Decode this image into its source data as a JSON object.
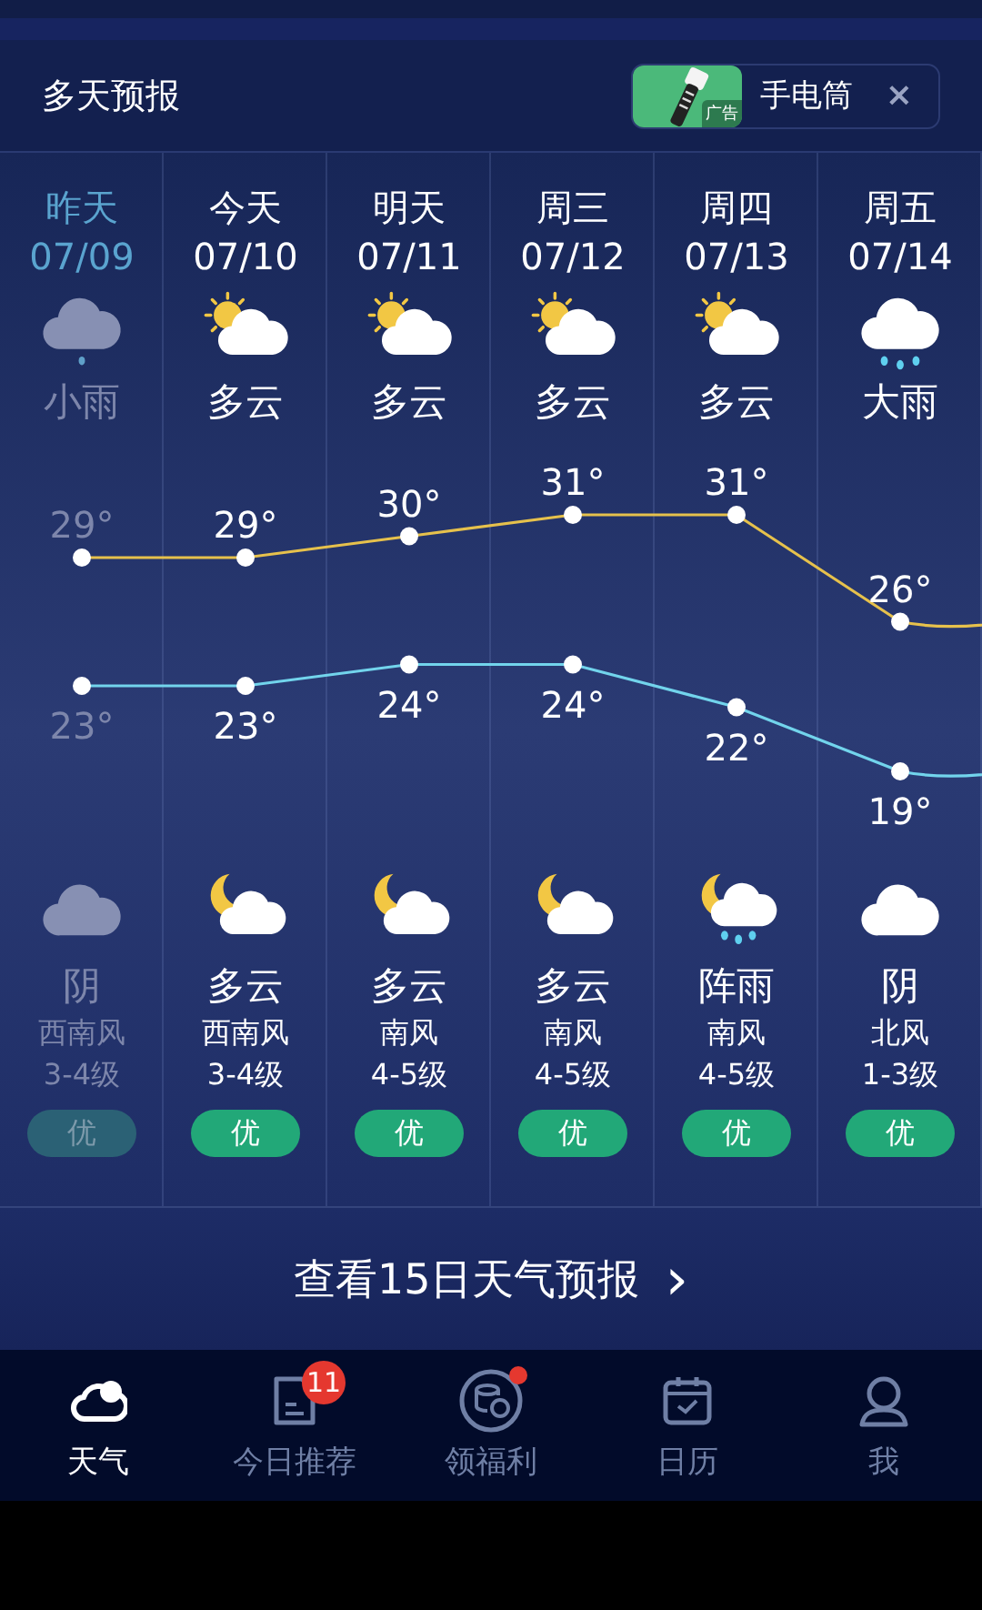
{
  "header": {
    "title": "多天预报",
    "ad": {
      "badge": "广告",
      "label": "手电筒",
      "close": "×"
    }
  },
  "days": [
    {
      "day": "昨天",
      "date": "07/09",
      "past": true,
      "daytime": {
        "kind": "rain",
        "condition": "小雨"
      },
      "night": {
        "kind": "cloud",
        "condition": "阴"
      },
      "wind": "西南风",
      "wind_level": "3-4级",
      "aqi": "优"
    },
    {
      "day": "今天",
      "date": "07/10",
      "past": false,
      "daytime": {
        "kind": "sun_cloud",
        "condition": "多云"
      },
      "night": {
        "kind": "moon_cloud",
        "condition": "多云"
      },
      "wind": "西南风",
      "wind_level": "3-4级",
      "aqi": "优"
    },
    {
      "day": "明天",
      "date": "07/11",
      "past": false,
      "daytime": {
        "kind": "sun_cloud",
        "condition": "多云"
      },
      "night": {
        "kind": "moon_cloud",
        "condition": "多云"
      },
      "wind": "南风",
      "wind_level": "4-5级",
      "aqi": "优"
    },
    {
      "day": "周三",
      "date": "07/12",
      "past": false,
      "daytime": {
        "kind": "sun_cloud",
        "condition": "多云"
      },
      "night": {
        "kind": "moon_cloud",
        "condition": "多云"
      },
      "wind": "南风",
      "wind_level": "4-5级",
      "aqi": "优"
    },
    {
      "day": "周四",
      "date": "07/13",
      "past": false,
      "daytime": {
        "kind": "sun_cloud",
        "condition": "多云"
      },
      "night": {
        "kind": "moon_rain",
        "condition": "阵雨"
      },
      "wind": "南风",
      "wind_level": "4-5级",
      "aqi": "优"
    },
    {
      "day": "周五",
      "date": "07/14",
      "past": false,
      "daytime": {
        "kind": "rain",
        "condition": "大雨"
      },
      "night": {
        "kind": "cloud",
        "condition": "阴"
      },
      "wind": "北风",
      "wind_level": "1-3级",
      "aqi": "优"
    }
  ],
  "chart_data": {
    "type": "line",
    "categories": [
      null,
      null,
      null,
      null,
      null,
      null
    ],
    "series": [
      {
        "color": "#e6c14c",
        "marker": "circle",
        "values": [
          29,
          29,
          30,
          31,
          31,
          26
        ],
        "value_labels": [
          "29°",
          "29°",
          "30°",
          "31°",
          "31°",
          "26°"
        ]
      },
      {
        "color": "#72d4ec",
        "marker": "circle",
        "values": [
          23,
          23,
          24,
          24,
          22,
          19
        ],
        "value_labels": [
          "23°",
          "23°",
          "24°",
          "24°",
          "22°",
          "19°"
        ]
      }
    ]
  },
  "more_button": {
    "label": "查看15日天气预报",
    "arrow": "›"
  },
  "nav": [
    {
      "label": "天气",
      "kind": "weather",
      "selected": true
    },
    {
      "label": "今日推荐",
      "kind": "doc",
      "selected": false,
      "badge": "11"
    },
    {
      "label": "领福利",
      "kind": "coins",
      "selected": false,
      "dot": true
    },
    {
      "label": "日历",
      "kind": "calendar",
      "selected": false
    },
    {
      "label": "我",
      "kind": "person",
      "selected": false
    }
  ]
}
